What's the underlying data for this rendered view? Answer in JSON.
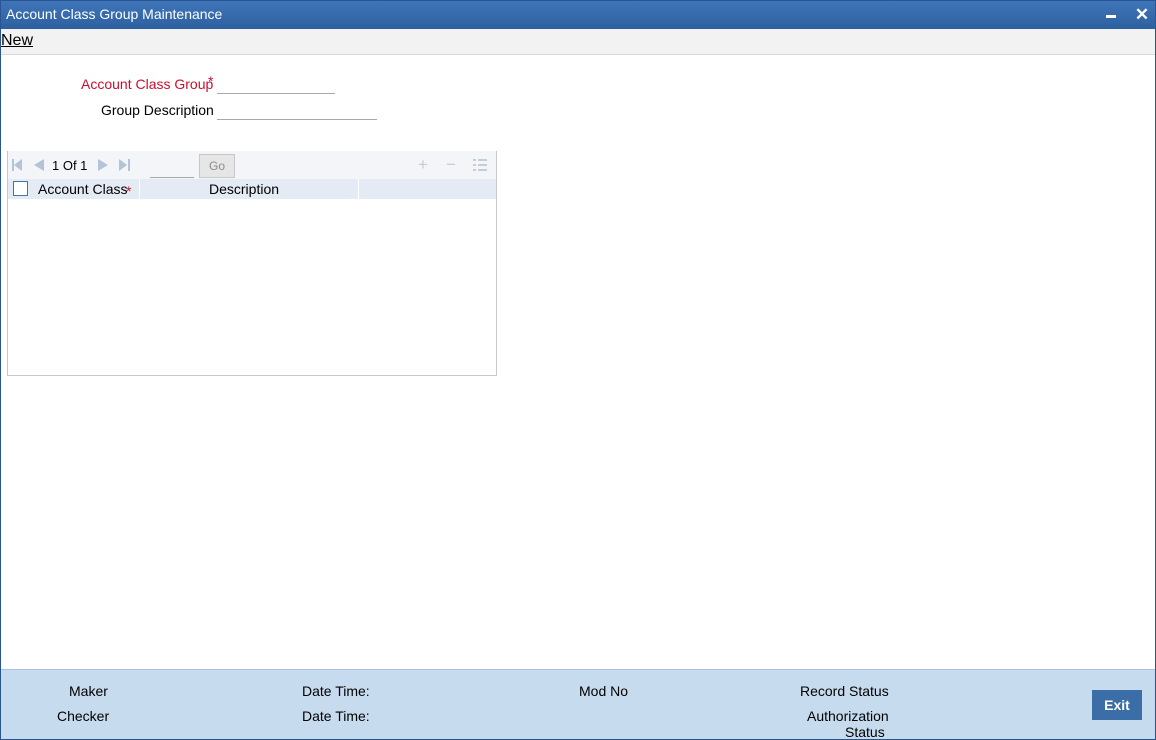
{
  "window": {
    "title": "Account Class Group Maintenance"
  },
  "menu": {
    "new_label": "New"
  },
  "form": {
    "account_class_group": {
      "label": "Account Class Group",
      "required_mark": "*",
      "value": ""
    },
    "group_description": {
      "label": "Group Description",
      "value": ""
    }
  },
  "grid": {
    "pagination": {
      "current": "1",
      "of_label": "Of",
      "total": "1",
      "text": "1 Of 1",
      "go_label": "Go",
      "page_value": ""
    },
    "columns": [
      {
        "label": "Account Class",
        "required_mark": "*"
      },
      {
        "label": "Description"
      }
    ],
    "rows": []
  },
  "footer": {
    "maker_label": "Maker",
    "checker_label": "Checker",
    "date_time_label_1": "Date Time:",
    "date_time_label_2": "Date Time:",
    "mod_no_label": "Mod No",
    "record_status_label": "Record Status",
    "authorization_status_label_line1": "Authorization",
    "authorization_status_label_line2": "Status",
    "exit_label": "Exit"
  },
  "colors": {
    "title_bar": "#2d609f",
    "required": "#c8102e",
    "footer_bg": "#c7dbef",
    "exit_button": "#3b6ea6"
  },
  "icons": {
    "minimize": "minimize-icon",
    "close": "close-icon",
    "first": "first-page-icon",
    "prev": "prev-page-icon",
    "next": "next-page-icon",
    "last": "last-page-icon",
    "add_row": "plus-icon",
    "delete_row": "minus-icon",
    "single_view": "list-icon"
  }
}
